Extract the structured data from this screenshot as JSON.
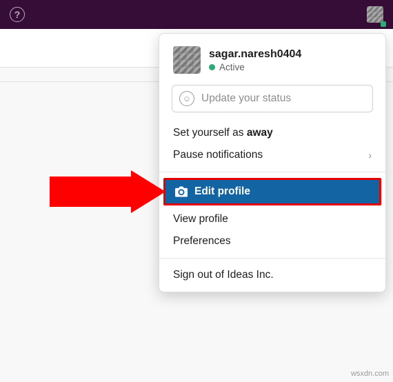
{
  "user": {
    "name": "sagar.naresh0404",
    "presence": "Active"
  },
  "status": {
    "placeholder": "Update your status"
  },
  "menu": {
    "set_away_prefix": "Set yourself as ",
    "set_away_bold": "away",
    "pause_notifications": "Pause notifications",
    "edit_profile": "Edit profile",
    "view_profile": "View profile",
    "preferences": "Preferences",
    "sign_out": "Sign out of Ideas Inc."
  },
  "watermark": "wsxdn.com"
}
